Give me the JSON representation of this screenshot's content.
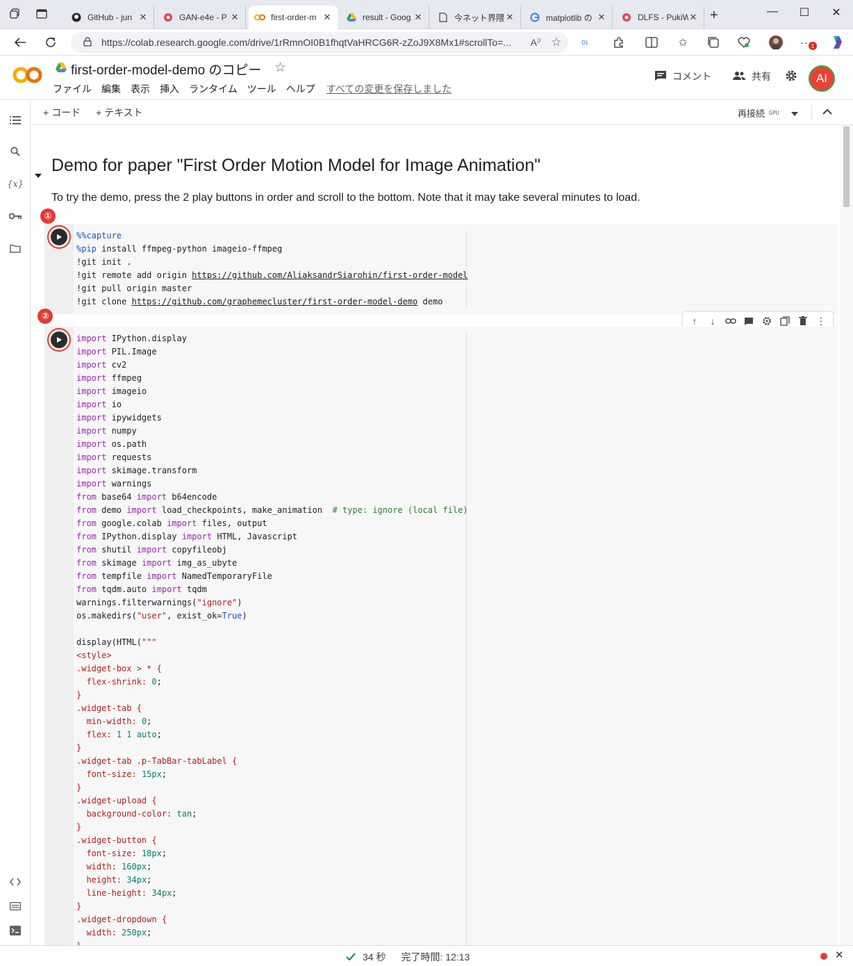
{
  "browser": {
    "tabs": [
      {
        "title": "GitHub - jun",
        "icon": "github-icon"
      },
      {
        "title": "GAN-e4e - P",
        "icon": "pukiwiki-icon"
      },
      {
        "title": "first-order-m",
        "icon": "colab-icon"
      },
      {
        "title": "result - Goog",
        "icon": "google-drive-icon"
      },
      {
        "title": "今ネット界隈で",
        "icon": "page-icon"
      },
      {
        "title": "matplotlib の",
        "icon": "google-icon"
      },
      {
        "title": "DLFS - PukiW",
        "icon": "pukiwiki-icon"
      }
    ],
    "active_tab_index": 2,
    "url": "https://colab.research.google.com/drive/1rRmnOI0B1fhqtVaHRCG6R-zZoJ9X8Mx1#scrollTo=...",
    "notification_badge": "1"
  },
  "colab": {
    "notebook_title": "first-order-model-demo のコピー",
    "menu": [
      "ファイル",
      "編集",
      "表示",
      "挿入",
      "ランタイム",
      "ツール",
      "ヘルプ"
    ],
    "saved_status": "すべての変更を保存しました",
    "comment_label": "コメント",
    "share_label": "共有",
    "avatar_initials": "AI",
    "toolbar": {
      "add_code": "+ コード",
      "add_text": "+ テキスト",
      "reconnect": "再接続",
      "gpu": "GPU"
    }
  },
  "notebook": {
    "heading": "Demo for paper \"First Order Motion Model for Image Animation\"",
    "intro": "To try the demo, press the 2 play buttons in order and scroll to the bottom. Note that it may take several minutes to load.",
    "markers": [
      "①",
      "②"
    ]
  },
  "status": {
    "duration": "34 秒",
    "completed": "完了時間: 12:13"
  },
  "colors": {
    "accent_red": "#e53935",
    "colab_orange": "#f9ab00",
    "keyword": "#9c27b0",
    "magic": "#1a53c4"
  }
}
